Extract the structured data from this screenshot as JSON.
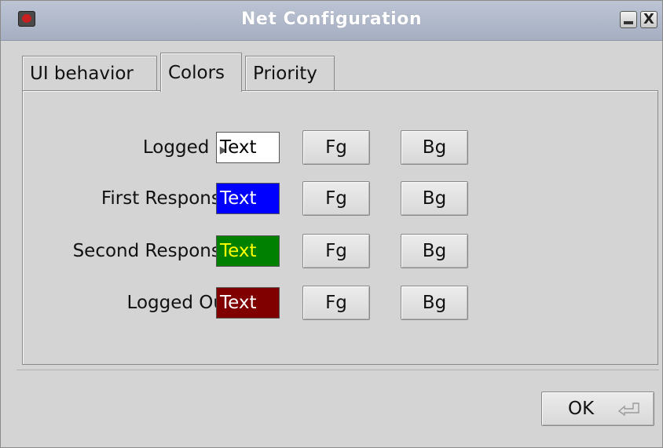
{
  "window": {
    "title": "Net Configuration",
    "minimize_glyph": "",
    "close_glyph": "X"
  },
  "tabs": [
    {
      "label": "UI behavior",
      "active": false
    },
    {
      "label": "Colors",
      "active": true
    },
    {
      "label": "Priority",
      "active": false
    }
  ],
  "rows": [
    {
      "label": "Logged In",
      "sample": "Text",
      "fg_color": "#000000",
      "bg_color": "#ffffff",
      "fg_button": "Fg",
      "bg_button": "Bg"
    },
    {
      "label": "First Response",
      "sample": "Text",
      "fg_color": "#ffffff",
      "bg_color": "#0000ff",
      "fg_button": "Fg",
      "bg_button": "Bg"
    },
    {
      "label": "Second Response",
      "sample": "Text",
      "fg_color": "#ffff00",
      "bg_color": "#008000",
      "fg_button": "Fg",
      "bg_button": "Bg"
    },
    {
      "label": "Logged Out",
      "sample": "Text",
      "fg_color": "#ffffff",
      "bg_color": "#800000",
      "fg_button": "Fg",
      "bg_button": "Bg"
    }
  ],
  "footer": {
    "ok_label": "OK",
    "ok_icon": "enter-key-icon"
  }
}
